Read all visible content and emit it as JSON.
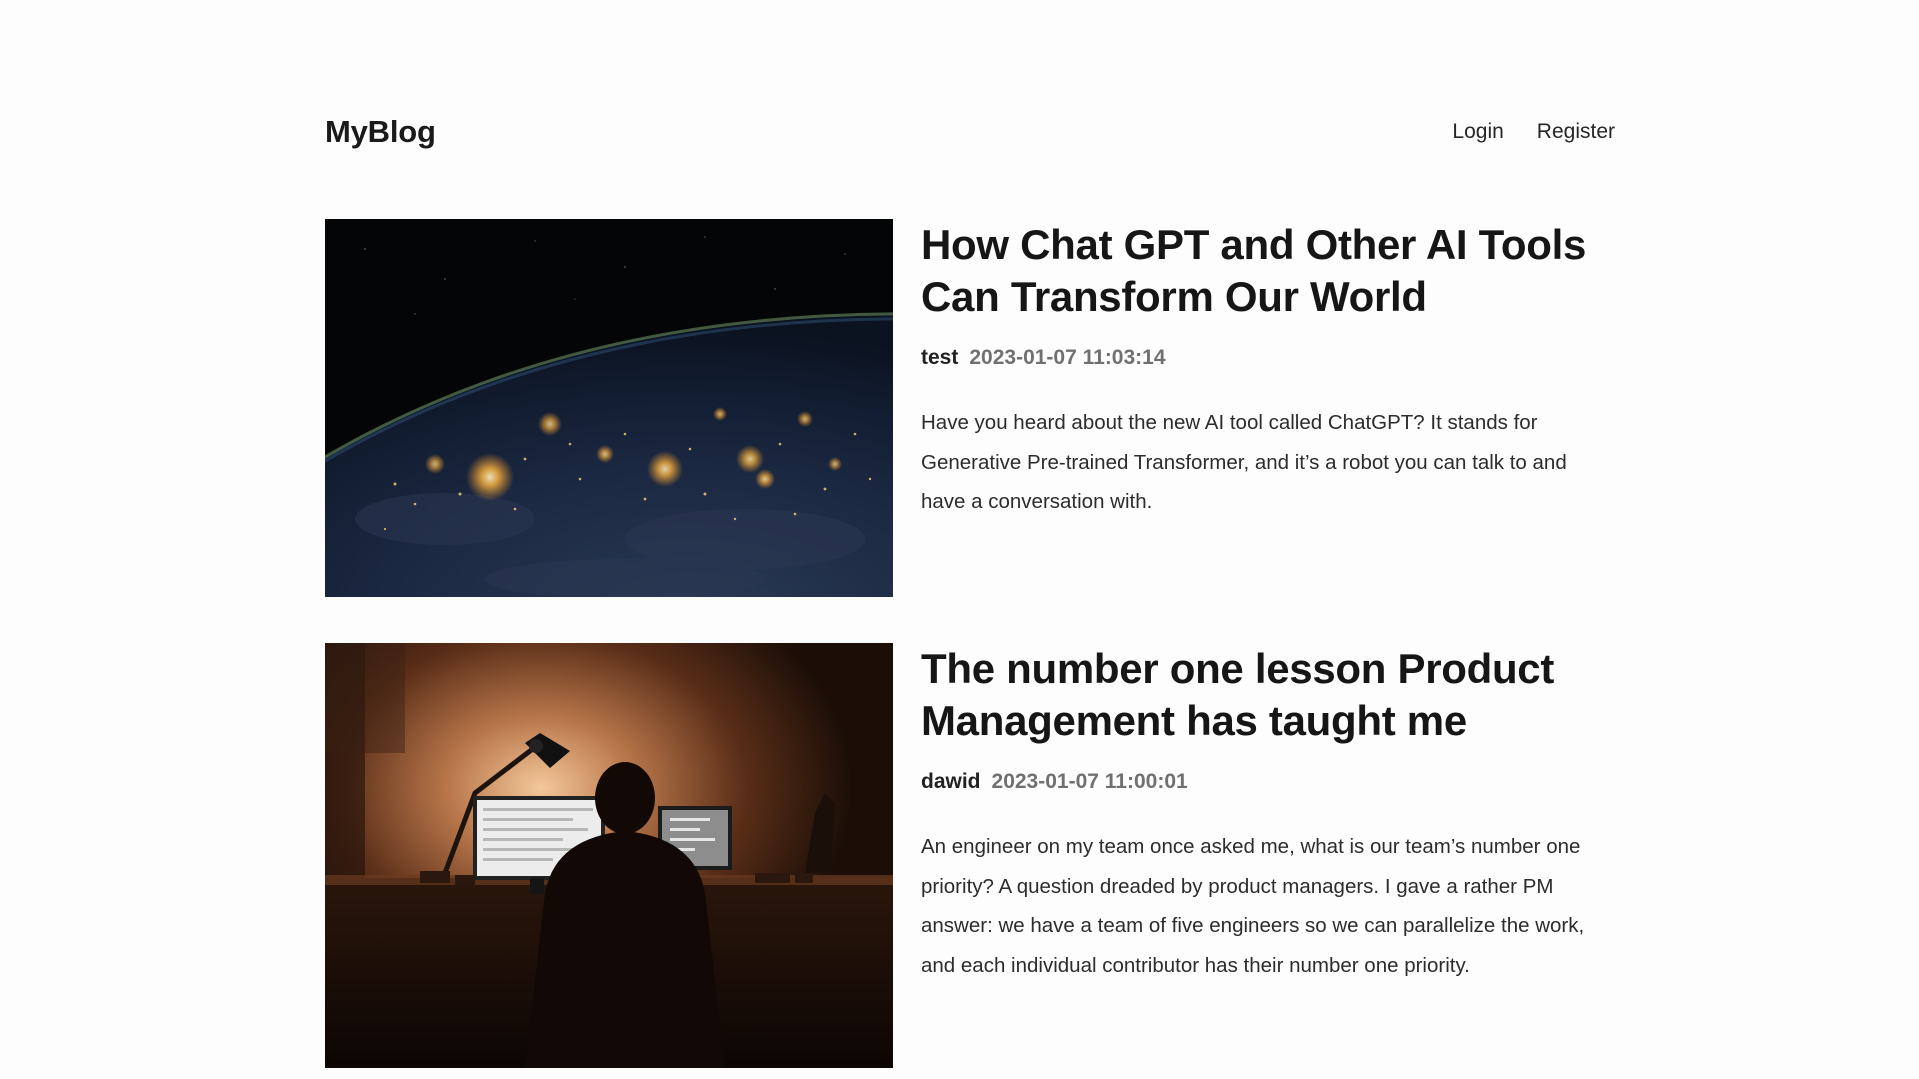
{
  "header": {
    "logo": "MyBlog",
    "nav": {
      "login": "Login",
      "register": "Register"
    }
  },
  "posts": [
    {
      "image": "earth-at-night-from-space",
      "title": "How Chat GPT and Other AI Tools Can Transform Our World",
      "author": "test",
      "date": "2023-01-07 11:03:14",
      "excerpt": "Have you heard about the new AI tool called ChatGPT? It stands for Generative Pre-trained Transformer, and it’s a robot you can talk to and have a conversation with."
    },
    {
      "image": "person-working-at-computer-in-dark-room",
      "title": "The number one lesson Product Management has taught me",
      "author": "dawid",
      "date": "2023-01-07 11:00:01",
      "excerpt": "An engineer on my team once asked me, what is our team’s number one priority? A question dreaded by product managers. I gave a rather PM answer: we have a team of five engineers so we can parallelize the work, and each individual contributor has their number one priority."
    }
  ]
}
